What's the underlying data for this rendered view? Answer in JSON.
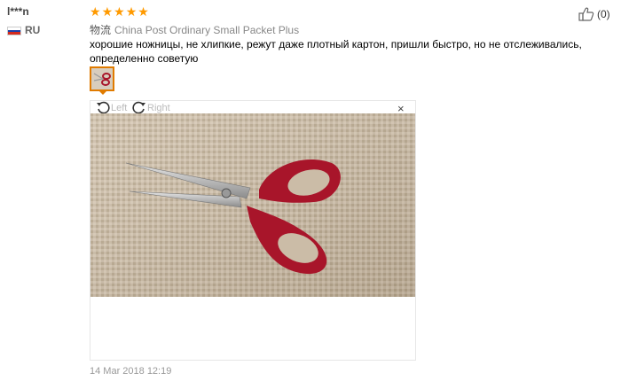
{
  "reviewer": {
    "name": "l***n",
    "country": "RU"
  },
  "rating": {
    "stars": 5,
    "max": 5
  },
  "logistics": {
    "label": "物流",
    "value": "China Post Ordinary Small Packet Plus"
  },
  "review_text": "хорошие ножницы, не хлипкие, режут даже плотный картон, пришли быстро, но не отслеживались, определенно советую",
  "viewer": {
    "rotate_left": "Left",
    "rotate_right": "Right",
    "close": "×"
  },
  "date": "14 Mar 2018 12:19",
  "helpful": {
    "count": "(0)"
  },
  "colors": {
    "star": "#ff9a00",
    "thumb_border": "#e07b00",
    "handle": "#a8152a"
  },
  "icons": [
    "thumbs-up-icon",
    "rotate-left-icon",
    "rotate-right-icon",
    "close-icon",
    "star-icon"
  ]
}
